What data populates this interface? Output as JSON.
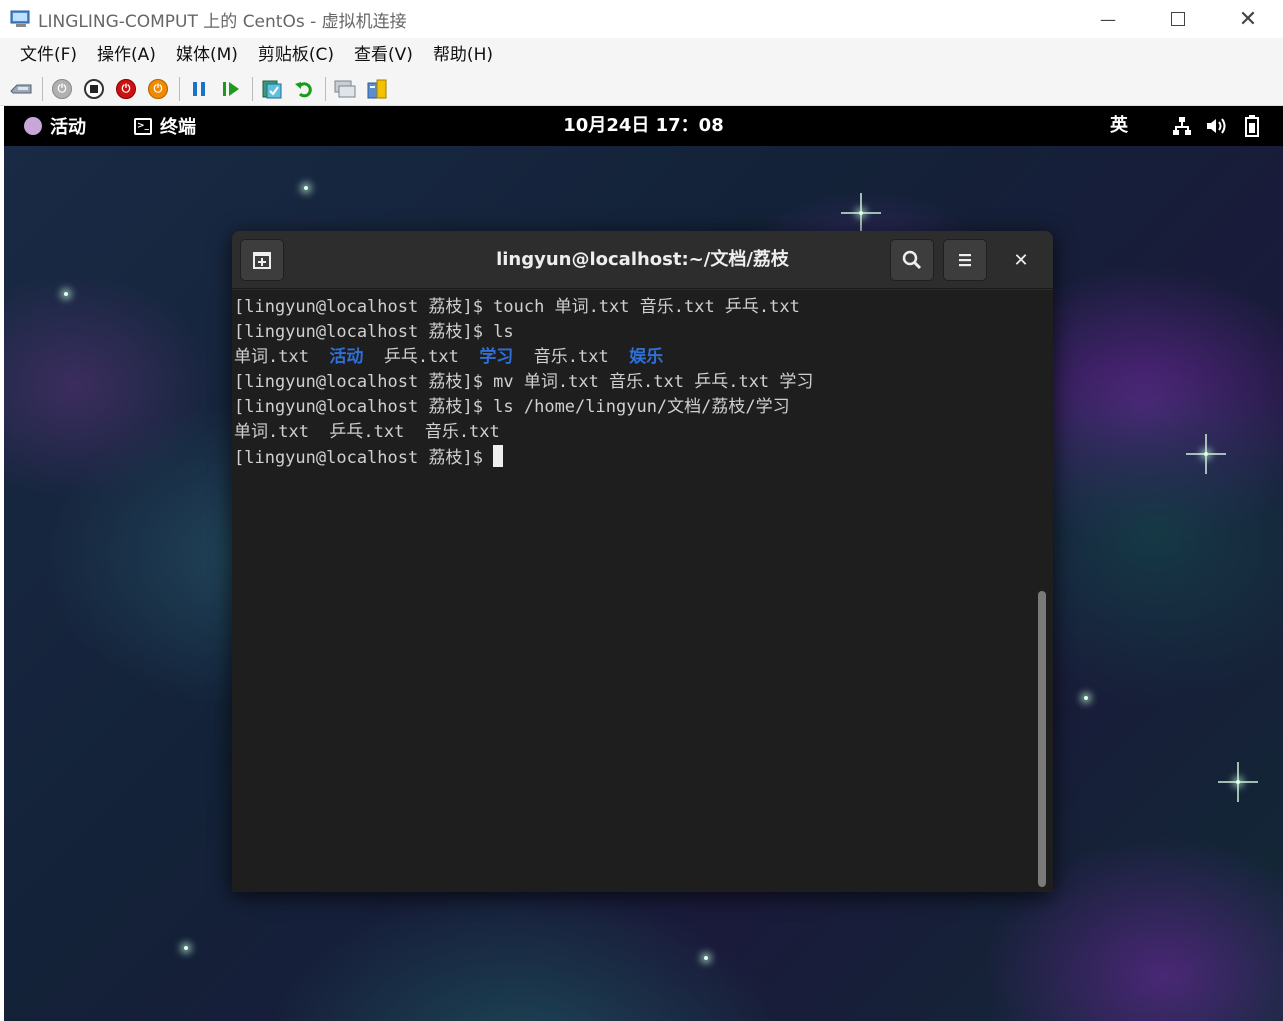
{
  "window": {
    "title": "LINGLING-COMPUT 上的 CentOs - 虚拟机连接",
    "controls": [
      "minimize-icon",
      "maximize-icon",
      "close-icon"
    ]
  },
  "menu": [
    "文件(F)",
    "操作(A)",
    "媒体(M)",
    "剪贴板(C)",
    "查看(V)",
    "帮助(H)"
  ],
  "toolbar": {
    "icons": [
      "ctrl-alt-del-icon",
      "start-icon",
      "turn-off-icon",
      "shutdown-icon",
      "save-state-icon",
      "pause-icon",
      "resume-icon",
      "checkpoint-icon",
      "revert-icon",
      "enhanced-session-icon",
      "share-icon"
    ],
    "colors": {
      "shutdown": "#cc1111",
      "save": "#f08a00",
      "pause": "#1a73c8",
      "resume": "#1a9b1a"
    }
  },
  "gnome": {
    "activities": "活动",
    "app_menu": "终端",
    "clock": "10月24日 17：08",
    "input_method": "英",
    "system_icons": [
      "network-icon",
      "volume-icon",
      "battery-icon"
    ]
  },
  "terminal": {
    "title": "lingyun@localhost:~/文档/荔枝",
    "lines": [
      [
        {
          "t": "[lingyun@localhost 荔枝]$ touch 单词.txt 音乐.txt 乒乓.txt"
        }
      ],
      [
        {
          "t": "[lingyun@localhost 荔枝]$ ls"
        }
      ],
      [
        {
          "t": "单词.txt  "
        },
        {
          "t": "活动",
          "dir": true
        },
        {
          "t": "  乒乓.txt  "
        },
        {
          "t": "学习",
          "dir": true
        },
        {
          "t": "  音乐.txt  "
        },
        {
          "t": "娱乐",
          "dir": true
        }
      ],
      [
        {
          "t": "[lingyun@localhost 荔枝]$ mv 单词.txt 音乐.txt 乒乓.txt 学习"
        }
      ],
      [
        {
          "t": "[lingyun@localhost 荔枝]$ ls /home/lingyun/文档/荔枝/学习"
        }
      ],
      [
        {
          "t": "单词.txt  乒乓.txt  音乐.txt"
        }
      ],
      [
        {
          "t": "[lingyun@localhost 荔枝]$ "
        },
        {
          "cursor": true
        }
      ]
    ],
    "directory_color": "#2f6fd6"
  }
}
